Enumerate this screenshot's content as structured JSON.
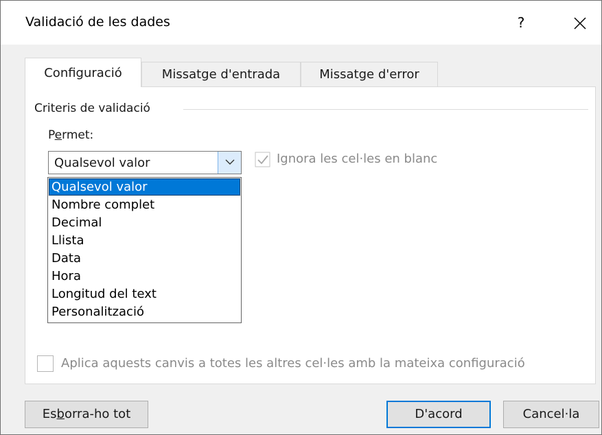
{
  "window": {
    "title": "Validació de les dades",
    "help_label": "?",
    "close_icon": "close-icon"
  },
  "tabs": [
    {
      "label": "Configuració",
      "active": true
    },
    {
      "label": "Missatge d'entrada",
      "active": false
    },
    {
      "label": "Missatge d'error",
      "active": false
    }
  ],
  "criteria": {
    "group_title": "Criteris de validació",
    "allow_label_pre": "P",
    "allow_label_accel": "e",
    "allow_label_post": "rmet:",
    "allow_value": "Qualsevol valor",
    "ignore_blank_label": "Ignora les cel·les en blanc",
    "ignore_blank_checked": true,
    "dropdown_options": [
      "Qualsevol valor",
      "Nombre complet",
      "Decimal",
      "Llista",
      "Data",
      "Hora",
      "Longitud del text",
      "Personalització"
    ],
    "selected_index": 0
  },
  "apply_all": {
    "label": "Aplica aquests canvis a totes les altres cel·les amb la mateixa configuració",
    "checked": false
  },
  "buttons": {
    "clear_pre": "Es",
    "clear_accel": "b",
    "clear_post": "orra-ho tot",
    "ok": "D'acord",
    "cancel": "Cancel·la"
  },
  "colors": {
    "accent": "#0078d7",
    "selection": "#0078d7",
    "disabled_text": "#8a8a8a"
  }
}
